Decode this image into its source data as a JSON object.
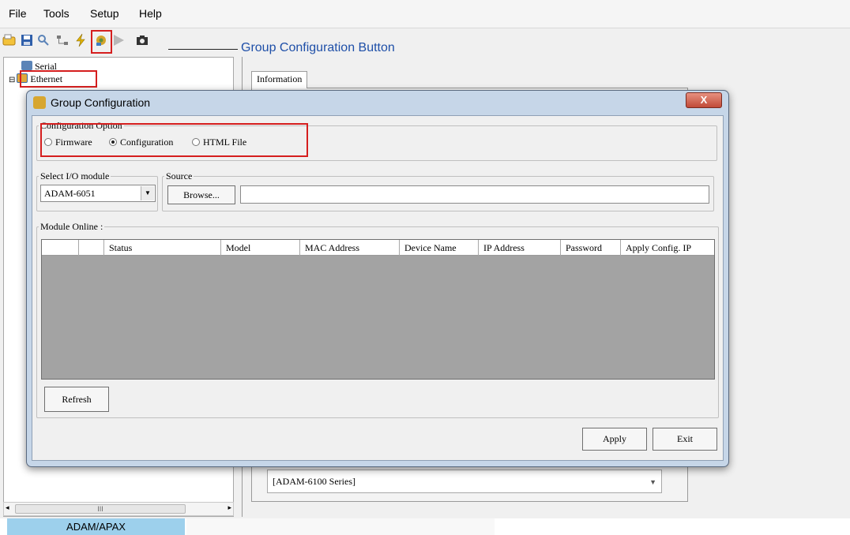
{
  "menu": [
    "File",
    "Tools",
    "Setup",
    "Help"
  ],
  "toolbar_icons": [
    "open-icon",
    "save-icon",
    "search-icon",
    "network-icon",
    "flash-icon",
    "group-config-icon",
    "play-icon",
    "camera-icon"
  ],
  "annotation": "Group Configuration Button",
  "tree": {
    "serial": "Serial",
    "ethernet": "Ethernet",
    "scroll_grip": "III"
  },
  "info_tab": "Information",
  "series_value": "[ADAM-6100 Series]",
  "status_bar": {
    "label": "ADAM/APAX"
  },
  "dialog": {
    "title": "Group Configuration",
    "close_label": "X",
    "config_option": {
      "legend": "Configuration Option",
      "options": [
        "Firmware",
        "Configuration",
        "HTML File"
      ],
      "selected": "Configuration"
    },
    "select_module": {
      "legend": "Select I/O module",
      "value": "ADAM-6051"
    },
    "source": {
      "legend": "Source",
      "browse_label": "Browse...",
      "value": ""
    },
    "module_online": {
      "legend": "Module Online :",
      "columns": [
        "Status",
        "Model",
        "MAC Address",
        "Device Name",
        "IP Address",
        "Password",
        "Apply Config. IP"
      ],
      "rows": []
    },
    "refresh_label": "Refresh",
    "apply_label": "Apply",
    "exit_label": "Exit"
  },
  "colors": {
    "highlight_box": "#d51e1e",
    "annotation_text": "#1e4fa8",
    "status_cell": "#9dd0ec",
    "grid_body": "#a3a3a3"
  }
}
